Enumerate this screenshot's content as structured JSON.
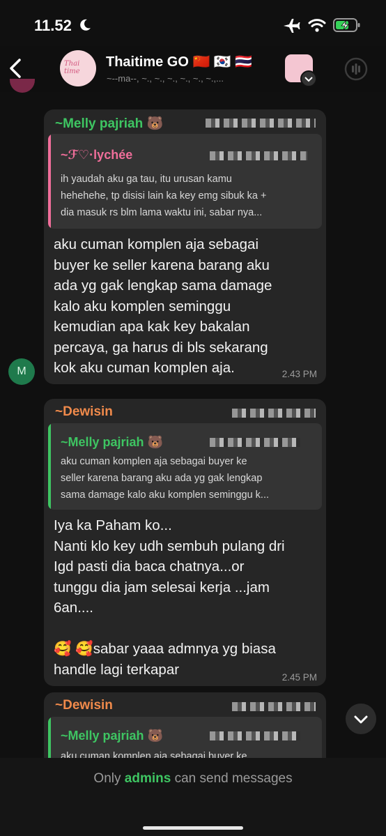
{
  "status_bar": {
    "time": "11.52"
  },
  "header": {
    "title": "Thaitime GO 🇨🇳 🇰🇷 🇹🇭",
    "subtitle": "~--ma--, ~., ~., ~., ~., ~., ~.,...",
    "avatar_text": "Thai time"
  },
  "messages": [
    {
      "sender": "~Melly pajriah 🐻",
      "quote": {
        "name": "~ℱ♡·lychée",
        "text": "ih yaudah aku ga tau, itu urusan kamu\nhehehehe, tp disisi lain ka key emg sibuk ka +\ndia masuk rs blm lama waktu ini, sabar nya..."
      },
      "text": "aku cuman komplen aja sebagai\nbuyer ke seller karena barang aku\nada yg gak lengkap sama damage\nkalo aku komplen seminggu\nkemudian apa kak key bakalan\npercaya, ga harus di bls sekarang\nkok aku cuman komplen aja.",
      "time": "2.43 PM",
      "avatar_letter": "M"
    },
    {
      "sender": "~Dewisin",
      "quote": {
        "name": "~Melly pajriah 🐻",
        "text": "aku cuman komplen aja sebagai buyer ke\nseller karena barang aku ada yg gak lengkap\nsama damage kalo aku komplen seminggu k..."
      },
      "text": "Iya ka Paham ko...\nNanti klo key udh sembuh pulang dri\nIgd pasti dia baca chatnya...or\ntunggu dia jam selesai kerja ...jam\n6an....\n\n🥰 🥰sabar yaaa admnya yg biasa\nhandle lagi terkapar",
      "time": "2.45 PM"
    },
    {
      "sender": "~Dewisin",
      "quote": {
        "name": "~Melly pajriah 🐻",
        "text": "aku cuman komplen aja sebagai buyer ke"
      }
    }
  ],
  "footer": {
    "prefix": "Only ",
    "accent": "admins",
    "suffix": " can send messages"
  },
  "colors": {
    "accent_green": "#3ec562",
    "accent_orange": "#f08a4b",
    "accent_pink": "#f06e9a",
    "bubble_bg": "#262626",
    "quote_bg": "#343434"
  },
  "icons": [
    "moon-icon",
    "airplane-icon",
    "wifi-icon",
    "battery-charging-icon",
    "back-chevron-icon",
    "voice-chat-icon",
    "chevron-down-icon"
  ]
}
